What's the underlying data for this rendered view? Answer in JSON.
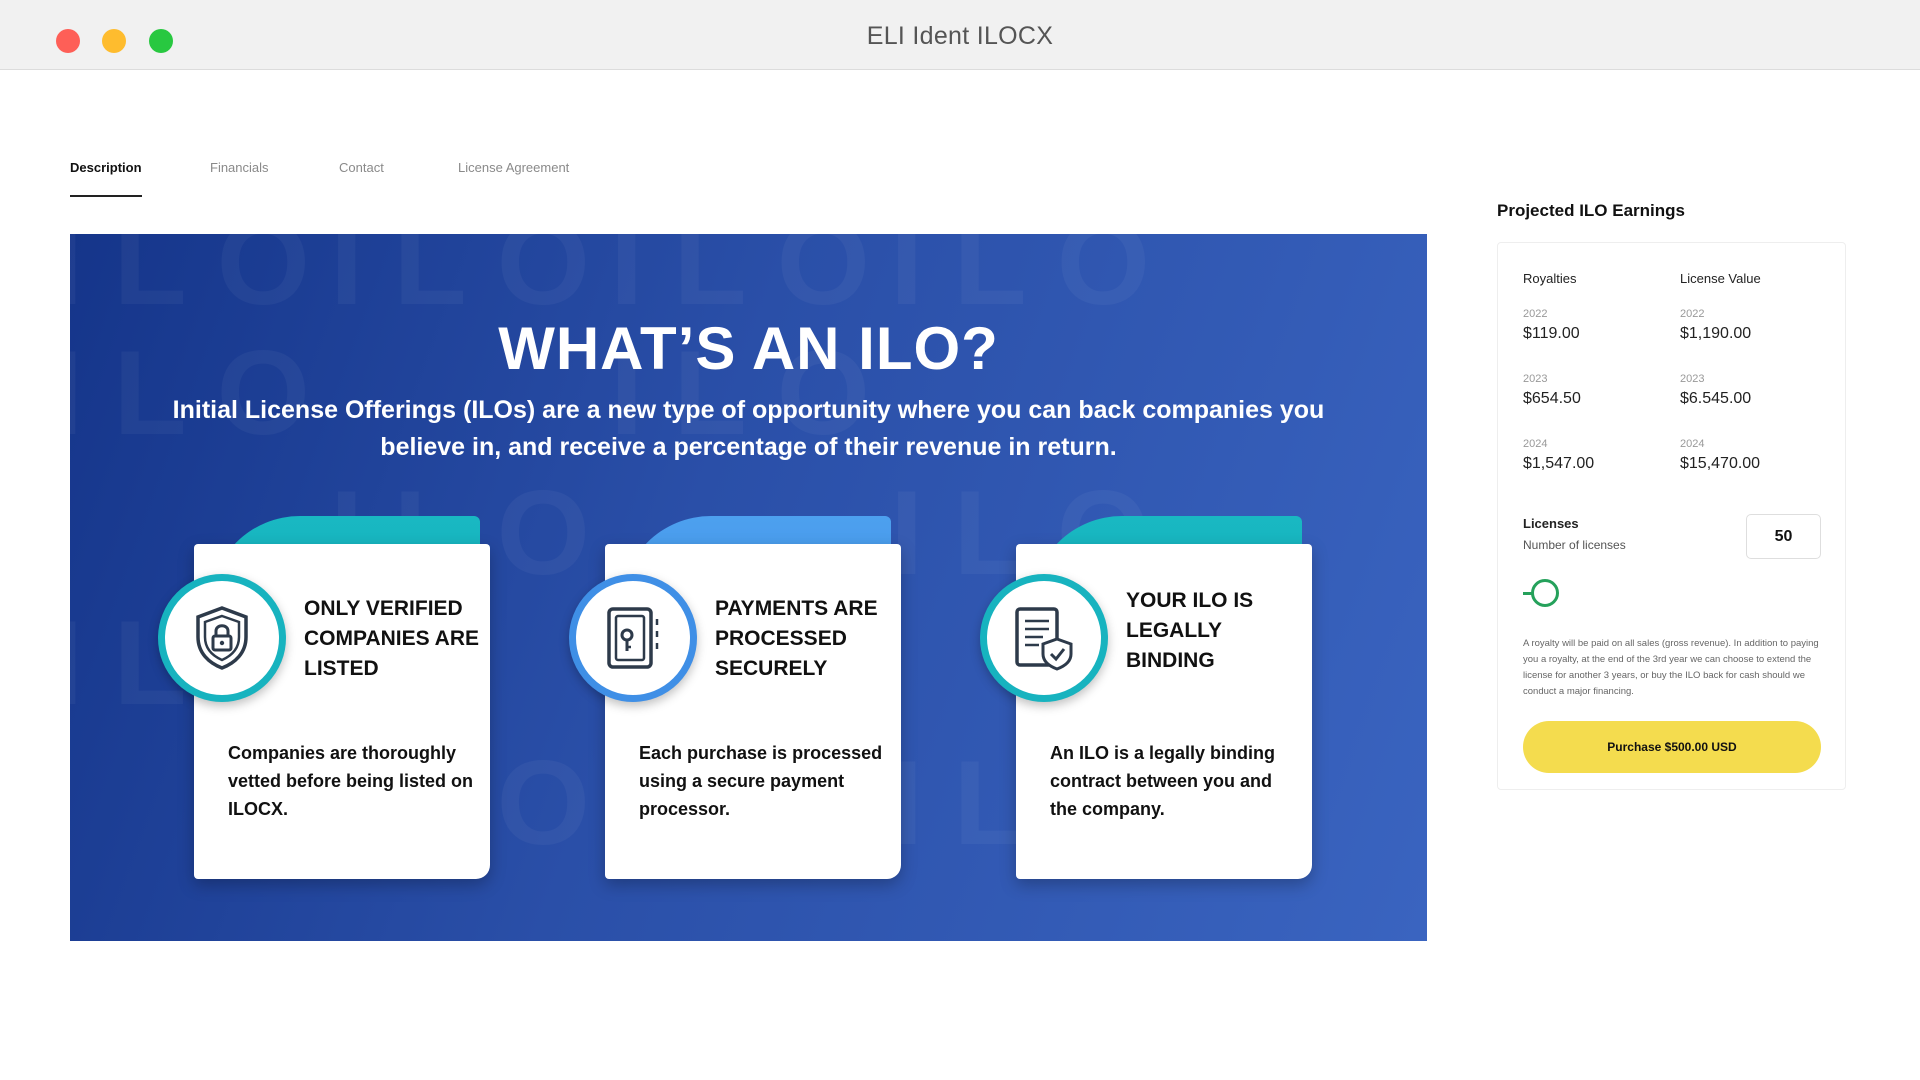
{
  "window": {
    "title": "ELI Ident ILOCX"
  },
  "tabs": [
    {
      "label": "Description",
      "active": true
    },
    {
      "label": "Financials",
      "active": false
    },
    {
      "label": "Contact",
      "active": false
    },
    {
      "label": "License Agreement",
      "active": false
    }
  ],
  "banner": {
    "heading": "WHAT’S AN ILO?",
    "subtitle": "Initial License Offerings (ILOs) are a new type of opportunity where you can back companies you believe in, and receive a percentage of their revenue in return.",
    "watermark": "ILO",
    "cards": [
      {
        "icon": "shield-lock-icon",
        "title": "ONLY VERIFIED COMPANIES ARE LISTED",
        "text": "Companies are thoroughly vetted before being listed on ILOCX."
      },
      {
        "icon": "secure-payment-icon",
        "title": "PAYMENTS ARE PROCESSED SECURELY",
        "text": "Each purchase is processed using a secure payment processor."
      },
      {
        "icon": "legal-document-icon",
        "title": "YOUR ILO IS LEGALLY BINDING",
        "text": "An ILO is a legally binding contract between you and the company."
      }
    ]
  },
  "earnings": {
    "title": "Projected ILO Earnings",
    "royalties_label": "Royalties",
    "license_value_label": "License Value",
    "rows": [
      {
        "year": "2022",
        "royalty": "$119.00",
        "license_value": "$1,190.00"
      },
      {
        "year": "2023",
        "royalty": "$654.50",
        "license_value": "$6.545.00"
      },
      {
        "year": "2024",
        "royalty": "$1,547.00",
        "license_value": "$15,470.00"
      }
    ],
    "licenses_label": "Licenses",
    "licenses_sub": "Number of licenses",
    "licenses_value": "50",
    "slider_fraction": 0.03,
    "disclaimer": "A royalty will be paid on all sales (gross revenue). In addition to paying you a royalty, at the end of the 3rd year we can choose to extend the license for another 3 years, or buy the ILO back for cash should we conduct a major financing.",
    "purchase_label": "Purchase $500.00 USD"
  },
  "colors": {
    "accent_yellow": "#f4dc4e",
    "slider_green": "#25a15b",
    "banner_blue": "#2a4fa8",
    "teal": "#17b3bf"
  }
}
